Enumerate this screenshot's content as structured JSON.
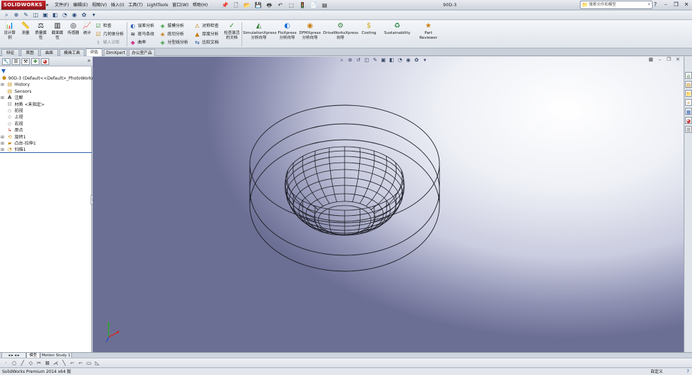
{
  "app": {
    "logo_text": "SOLIDWORKS",
    "document_title": "90D-3"
  },
  "menus": [
    "文件(F)",
    "编辑(E)",
    "视图(V)",
    "插入(I)",
    "工具(T)",
    "LightTools",
    "窗口(W)",
    "帮助(H)"
  ],
  "search": {
    "placeholder": "搜索文件和模型"
  },
  "command_manager": {
    "big_buttons": [
      "设计算例",
      "测量",
      "质量属性",
      "截面属性",
      "传感器",
      "统计"
    ],
    "col1": [
      "检查",
      "几何体分析",
      "输入诊断"
    ],
    "col2": [
      "误差分析",
      "斑马条纹",
      "曲率"
    ],
    "col3": [
      "拔模分析",
      "底切分析",
      "分型线分析"
    ],
    "col4": [
      "对称检查",
      "厚度分析",
      "比较文档"
    ],
    "check_active": "检查激活的文档",
    "xpress": [
      "SimulationXpress 分析向导",
      "FloXpress 分析向导",
      "DFMXpress 分析向导",
      "DriveWorksXpress 向导",
      "Costing",
      "Sustainability",
      "Part Reviewer"
    ]
  },
  "tabs": [
    "特征",
    "草图",
    "曲面",
    "模具工具",
    "评估",
    "DimXpert",
    "办公室产品"
  ],
  "active_tab": "评估",
  "feature_tree": {
    "root": "90D-3  (Default<<Default>_PhotoWorks",
    "items": [
      "History",
      "Sensors",
      "注解",
      "材质 <未指定>",
      "前视",
      "上视",
      "右视",
      "原点",
      "旋转1",
      "凸台-拉伸1",
      "扫描1"
    ]
  },
  "bottom_tabs": [
    "模型",
    "Motion Study 1"
  ],
  "status": {
    "left": "SolidWorks Premium 2014 x64 版",
    "right": "自定义"
  },
  "colors": {
    "logo_red": "#c9252c",
    "tree_selection": "#2f5ea8"
  }
}
